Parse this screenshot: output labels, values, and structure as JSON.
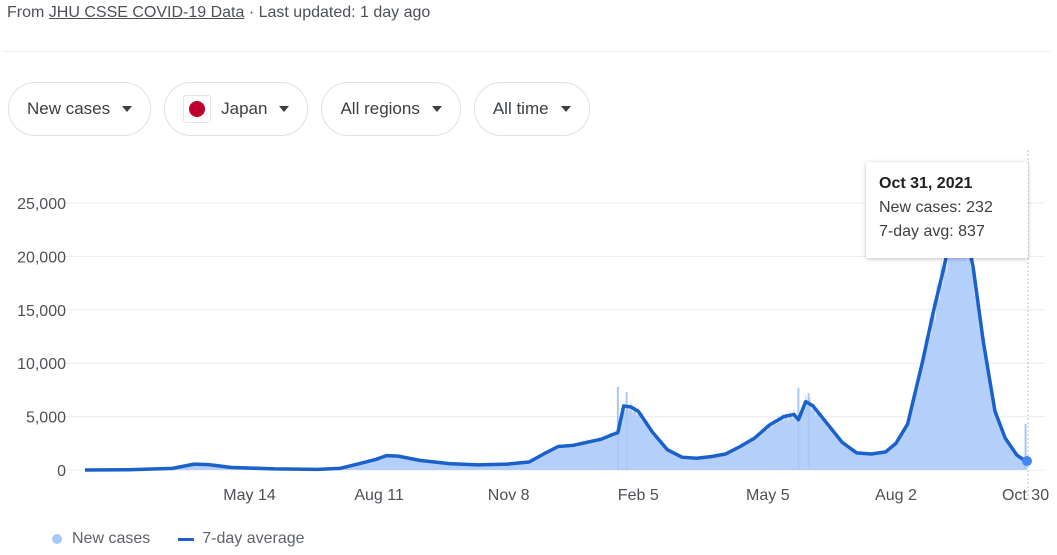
{
  "source": {
    "prefix": "From ",
    "link": "JHU CSSE COVID-19 Data",
    "suffix": " · Last updated: 1 day ago"
  },
  "filters": [
    {
      "label": "New cases",
      "icon": "caret-down-icon"
    },
    {
      "label": "Japan",
      "icon": "japan-flag-icon"
    },
    {
      "label": "All regions",
      "icon": "caret-down-icon"
    },
    {
      "label": "All time",
      "icon": "caret-down-icon"
    }
  ],
  "tooltip": {
    "date": "Oct 31, 2021",
    "new_cases": "New cases: 232",
    "avg": "7-day avg: 837"
  },
  "legend": {
    "new_cases": "New cases",
    "avg": "7-day average"
  },
  "colors": {
    "bars": "#a8c7fa",
    "line": "#1a62c9",
    "grid": "#ececec"
  },
  "chart_data": {
    "type": "area",
    "title": "",
    "xlabel": "",
    "ylabel": "",
    "ylim": [
      0,
      25000
    ],
    "yticks": [
      "0",
      "5,000",
      "10,000",
      "15,000",
      "20,000",
      "25,000"
    ],
    "ytick_values": [
      0,
      5000,
      10000,
      15000,
      20000,
      25000
    ],
    "xticks": [
      "May 14",
      "Aug 11",
      "Nov 8",
      "Feb 5",
      "May 5",
      "Aug 2",
      "Oct 30"
    ],
    "xtick_days": [
      113,
      202,
      291,
      380,
      469,
      557,
      646
    ],
    "x_days_range": [
      0,
      647
    ],
    "grid": true,
    "legend_position": "bottom-left",
    "series": [
      {
        "name": "7-day average",
        "points": [
          [
            0,
            0
          ],
          [
            30,
            20
          ],
          [
            60,
            150
          ],
          [
            75,
            550
          ],
          [
            85,
            500
          ],
          [
            100,
            250
          ],
          [
            130,
            100
          ],
          [
            160,
            60
          ],
          [
            175,
            150
          ],
          [
            190,
            650
          ],
          [
            200,
            1000
          ],
          [
            207,
            1350
          ],
          [
            215,
            1300
          ],
          [
            230,
            900
          ],
          [
            250,
            600
          ],
          [
            270,
            480
          ],
          [
            290,
            550
          ],
          [
            305,
            750
          ],
          [
            315,
            1500
          ],
          [
            325,
            2200
          ],
          [
            335,
            2300
          ],
          [
            345,
            2600
          ],
          [
            355,
            2900
          ],
          [
            362,
            3300
          ],
          [
            366,
            3500
          ],
          [
            370,
            6000
          ],
          [
            375,
            5900
          ],
          [
            380,
            5500
          ],
          [
            390,
            3500
          ],
          [
            400,
            1900
          ],
          [
            410,
            1200
          ],
          [
            420,
            1100
          ],
          [
            430,
            1250
          ],
          [
            440,
            1500
          ],
          [
            450,
            2200
          ],
          [
            460,
            3000
          ],
          [
            470,
            4200
          ],
          [
            480,
            5000
          ],
          [
            487,
            5200
          ],
          [
            490,
            4700
          ],
          [
            495,
            6400
          ],
          [
            500,
            6000
          ],
          [
            510,
            4300
          ],
          [
            520,
            2600
          ],
          [
            530,
            1600
          ],
          [
            540,
            1500
          ],
          [
            550,
            1700
          ],
          [
            557,
            2500
          ],
          [
            565,
            4300
          ],
          [
            575,
            10000
          ],
          [
            583,
            15000
          ],
          [
            590,
            19000
          ],
          [
            597,
            23500
          ],
          [
            603,
            23500
          ],
          [
            610,
            19000
          ],
          [
            617,
            12000
          ],
          [
            625,
            5500
          ],
          [
            632,
            3000
          ],
          [
            640,
            1400
          ],
          [
            646,
            837
          ]
        ]
      },
      {
        "name": "New cases",
        "note": "daily bars approximated around the 7-day average, with spikes near Jan 2021 (~7,800) and May 2021 (~7,700)",
        "spikes": [
          [
            366,
            7800
          ],
          [
            372,
            7300
          ],
          [
            490,
            7700
          ],
          [
            497,
            7200
          ],
          [
            646,
            4300
          ]
        ],
        "last_value": 232
      }
    ],
    "tooltip": {
      "date": "Oct 31, 2021",
      "new_cases": 232,
      "avg_7day": 837
    }
  }
}
